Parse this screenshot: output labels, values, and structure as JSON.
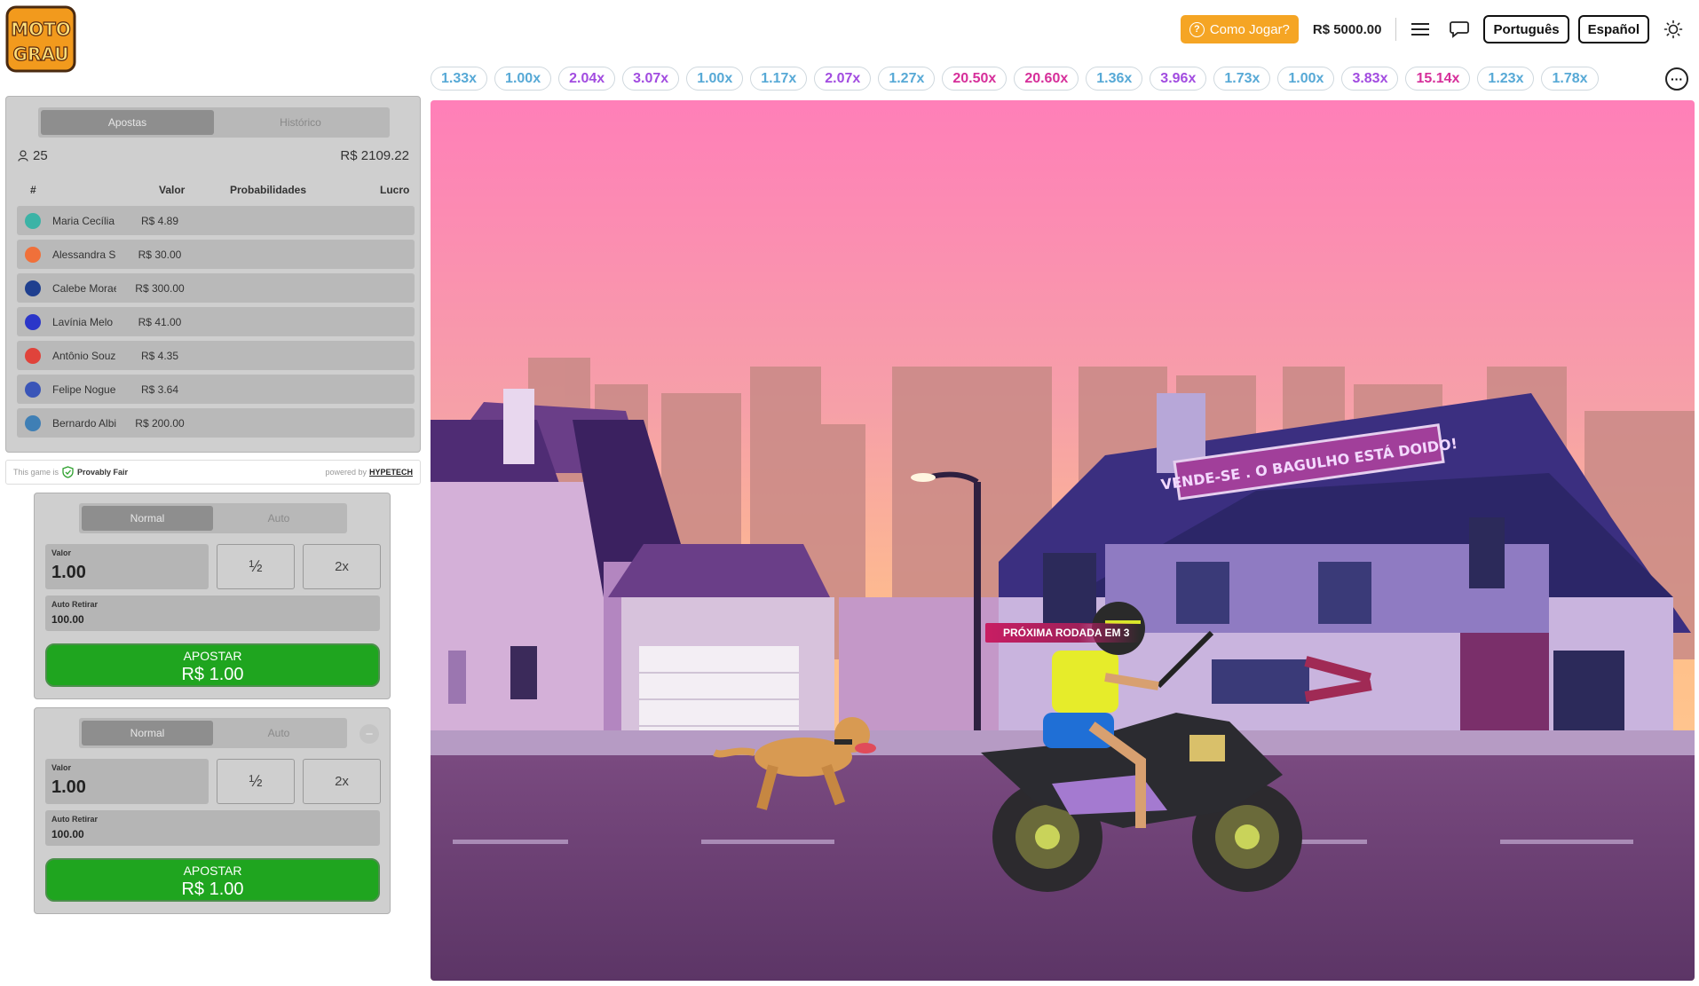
{
  "header": {
    "logo_text_top": "MOTO",
    "logo_text_bottom": "GRAU",
    "how_to_play": "Como Jogar?",
    "balance": "R$ 5000.00",
    "lang_pt": "Português",
    "lang_es": "Español"
  },
  "multipliers": [
    {
      "value": "1.33x",
      "color": "blue"
    },
    {
      "value": "1.00x",
      "color": "blue"
    },
    {
      "value": "2.04x",
      "color": "purple"
    },
    {
      "value": "3.07x",
      "color": "purple"
    },
    {
      "value": "1.00x",
      "color": "blue"
    },
    {
      "value": "1.17x",
      "color": "blue"
    },
    {
      "value": "2.07x",
      "color": "purple"
    },
    {
      "value": "1.27x",
      "color": "blue"
    },
    {
      "value": "20.50x",
      "color": "pink"
    },
    {
      "value": "20.60x",
      "color": "pink"
    },
    {
      "value": "1.36x",
      "color": "blue"
    },
    {
      "value": "3.96x",
      "color": "purple"
    },
    {
      "value": "1.73x",
      "color": "blue"
    },
    {
      "value": "1.00x",
      "color": "blue"
    },
    {
      "value": "3.83x",
      "color": "purple"
    },
    {
      "value": "15.14x",
      "color": "pink"
    },
    {
      "value": "1.23x",
      "color": "blue"
    },
    {
      "value": "1.78x",
      "color": "blue"
    }
  ],
  "bets": {
    "tab_bets": "Apostas",
    "tab_history": "Histórico",
    "player_count": "25",
    "total": "R$ 2109.22",
    "columns": {
      "index": "#",
      "value": "Valor",
      "odds": "Probabilidades",
      "profit": "Lucro"
    },
    "rows": [
      {
        "name": "Maria Cecília",
        "value": "R$ 4.89",
        "avatar_color": "#3cb3a6"
      },
      {
        "name": "Alessandra S",
        "value": "R$ 30.00",
        "avatar_color": "#f0703a"
      },
      {
        "name": "Calebe Morae",
        "value": "R$ 300.00",
        "avatar_color": "#1f3f8f"
      },
      {
        "name": "Lavínia Melo",
        "value": "R$ 41.00",
        "avatar_color": "#2b36c9"
      },
      {
        "name": "Antônio Souz",
        "value": "R$ 4.35",
        "avatar_color": "#e0433b"
      },
      {
        "name": "Felipe Nogue",
        "value": "R$ 3.64",
        "avatar_color": "#3a55b8"
      },
      {
        "name": "Bernardo Albi",
        "value": "R$ 200.00",
        "avatar_color": "#3f7fb5"
      }
    ]
  },
  "fair": {
    "prefix": "This game is",
    "label": "Provably Fair",
    "powered": "powered by",
    "brand": "HYPETECH"
  },
  "bet_panels": [
    {
      "tab_normal": "Normal",
      "tab_auto": "Auto",
      "value_label": "Valor",
      "value": "1.00",
      "half": "½",
      "double": "2x",
      "auto_label": "Auto Retirar",
      "auto_value": "100.00",
      "button_label": "APOSTAR",
      "button_amount": "R$ 1.00"
    },
    {
      "tab_normal": "Normal",
      "tab_auto": "Auto",
      "value_label": "Valor",
      "value": "1.00",
      "half": "½",
      "double": "2x",
      "auto_label": "Auto Retirar",
      "auto_value": "100.00",
      "button_label": "APOSTAR",
      "button_amount": "R$ 1.00"
    }
  ],
  "game": {
    "countdown": "PRÓXIMA RODADA EM 3",
    "sign": "VENDE-SE . O BAGULHO ESTÁ DOIDO!"
  },
  "colors": {
    "accent": "#f5a524",
    "bet_button": "#1fa51f",
    "mult_blue": "#57a9d6",
    "mult_purple": "#a24ce0",
    "mult_pink": "#d62f9a"
  }
}
